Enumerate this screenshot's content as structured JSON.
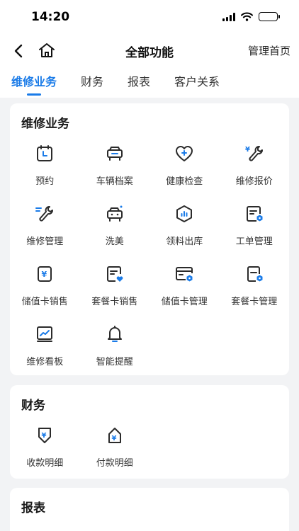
{
  "status_bar": {
    "time": "14:20"
  },
  "navbar": {
    "title": "全部功能",
    "right_link": "管理首页"
  },
  "tabs": [
    {
      "label": "维修业务",
      "active": true
    },
    {
      "label": "财务",
      "active": false
    },
    {
      "label": "报表",
      "active": false
    },
    {
      "label": "客户关系",
      "active": false
    }
  ],
  "sections": {
    "repair": {
      "title": "维修业务",
      "items": [
        {
          "label": "预约",
          "icon": "calendar-icon"
        },
        {
          "label": "车辆档案",
          "icon": "car-icon"
        },
        {
          "label": "健康检查",
          "icon": "heart-plus-icon"
        },
        {
          "label": "维修报价",
          "icon": "wrench-yen-icon"
        },
        {
          "label": "维修管理",
          "icon": "wrench-lines-icon"
        },
        {
          "label": "洗美",
          "icon": "car-sparkle-icon"
        },
        {
          "label": "领料出库",
          "icon": "hexagon-chart-icon"
        },
        {
          "label": "工单管理",
          "icon": "doc-hexagon-icon"
        },
        {
          "label": "储值卡销售",
          "icon": "yen-card-icon"
        },
        {
          "label": "套餐卡销售",
          "icon": "doc-heart-icon"
        },
        {
          "label": "储值卡管理",
          "icon": "card-hexagon-icon"
        },
        {
          "label": "套餐卡管理",
          "icon": "package-card-hexagon-icon"
        },
        {
          "label": "维修看板",
          "icon": "dashboard-chart-icon"
        },
        {
          "label": "智能提醒",
          "icon": "bell-icon"
        }
      ]
    },
    "finance": {
      "title": "财务",
      "items": [
        {
          "label": "收款明细",
          "icon": "receive-yen-icon"
        },
        {
          "label": "付款明细",
          "icon": "pay-yen-icon"
        }
      ]
    },
    "report": {
      "title": "报表"
    }
  },
  "colors": {
    "accent": "#1a7be8",
    "icon_stroke": "#2b2b2b",
    "background": "#f2f3f5"
  }
}
